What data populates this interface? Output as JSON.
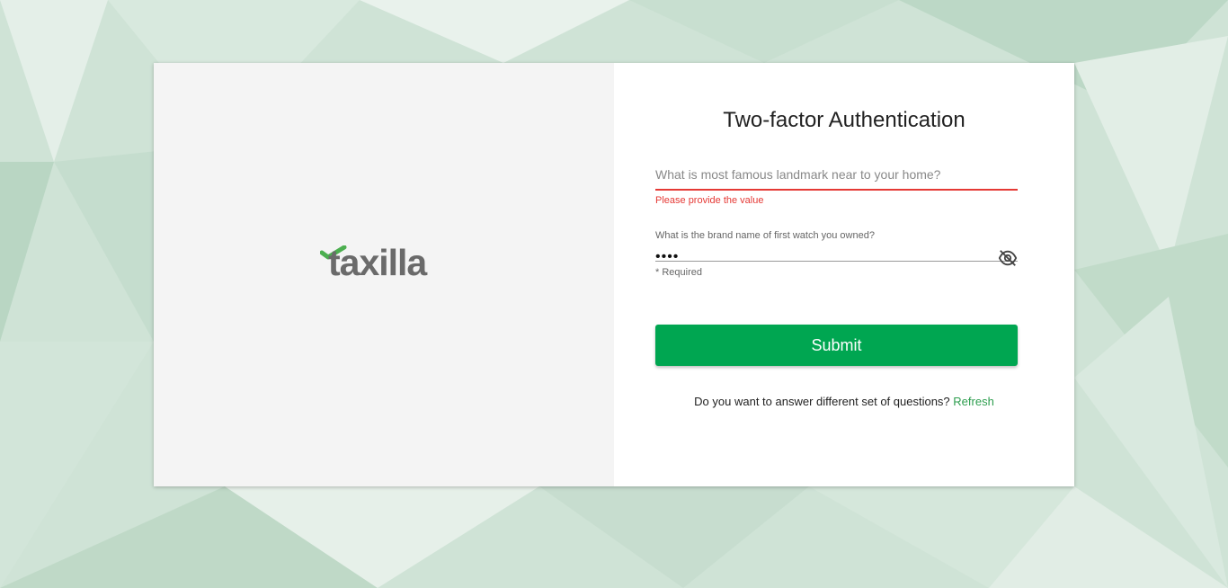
{
  "colors": {
    "accent": "#00a651",
    "error": "#e53935",
    "link": "#2e9e4f",
    "background": "#cfe3d6"
  },
  "brand": {
    "logo_text": "taxilla",
    "logo_icon": "checkmark-icon"
  },
  "form": {
    "title": "Two-factor Authentication",
    "question1": {
      "placeholder": "What is most famous landmark near to your home?",
      "value": "",
      "error": "Please provide the value"
    },
    "question2": {
      "label": "What is the brand name of first watch you owned?",
      "value": "••••",
      "hint": "* Required",
      "toggle_icon": "eye-off-icon"
    },
    "submit_label": "Submit",
    "refresh_prompt": "Do you want to answer different set of questions?",
    "refresh_link": "Refresh"
  }
}
